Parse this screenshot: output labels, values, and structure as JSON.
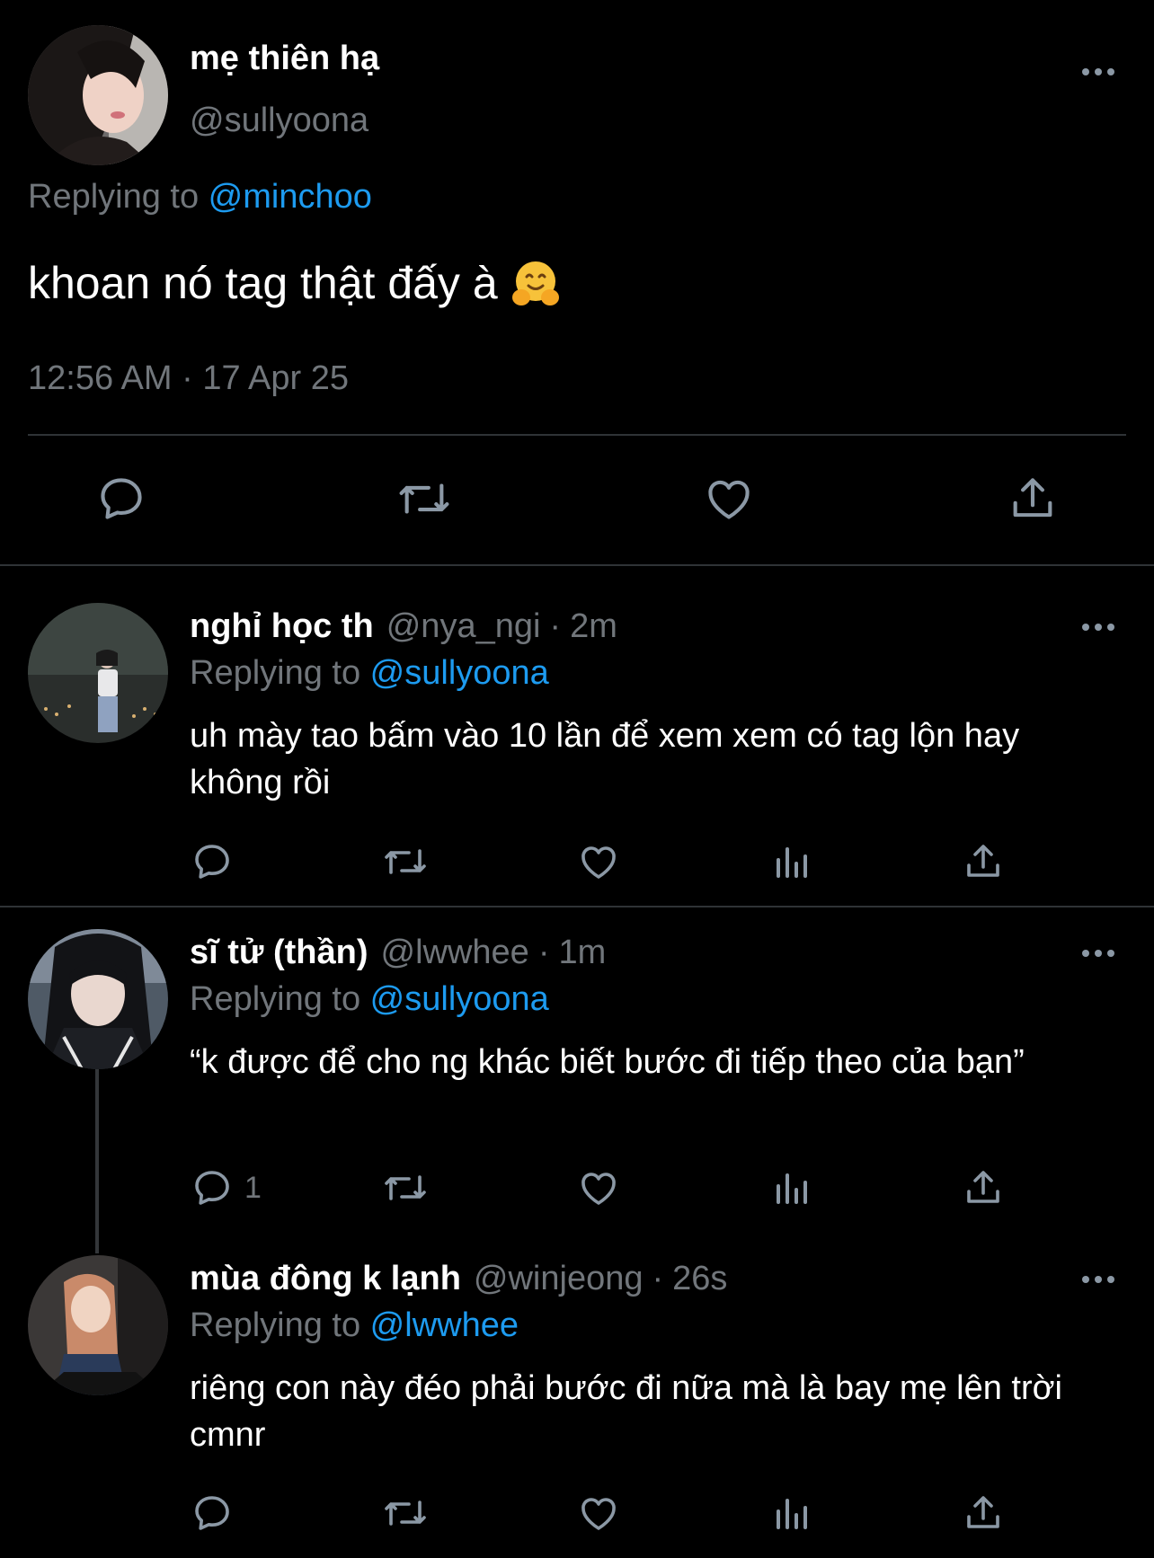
{
  "main_tweet": {
    "display_name": "mẹ thiên hạ",
    "handle": "@sullyoona",
    "replying_label": "Replying to ",
    "replying_to": "@minchoo",
    "text": "khoan nó tag thật đấy à",
    "emoji_icon": "hugging-face-emoji",
    "timestamp": "12:56 AM · 17 Apr 25"
  },
  "replies": [
    {
      "display_name": "nghỉ học th",
      "handle": "@nya_ngi",
      "separator": "·",
      "time": "2m",
      "replying_label": "Replying to ",
      "replying_to": "@sullyoona",
      "text": "uh mày tao bấm vào 10 lần để xem xem có tag lộn hay không rồi",
      "reply_count": ""
    },
    {
      "display_name": "sĩ tử (thần)",
      "handle": "@lwwhee",
      "separator": "·",
      "time": "1m",
      "replying_label": "Replying to ",
      "replying_to": "@sullyoona",
      "text": "“k được để cho ng khác biết bước đi tiếp theo của bạn”",
      "reply_count": "1"
    },
    {
      "display_name": "mùa đông k lạnh",
      "handle": "@winjeong",
      "separator": "·",
      "time": "26s",
      "replying_label": "Replying to ",
      "replying_to": "@lwwhee",
      "text": "riêng con này đéo phải bước đi nữa mà là bay mẹ lên trời cmnr",
      "reply_count": ""
    }
  ],
  "colors": {
    "background": "#000000",
    "text_primary": "#ffffff",
    "text_secondary": "#71767b",
    "link": "#1d9bf0",
    "divider": "#2f3336"
  },
  "icons": [
    "more-icon",
    "reply-icon",
    "retweet-icon",
    "like-icon",
    "analytics-icon",
    "share-icon"
  ]
}
